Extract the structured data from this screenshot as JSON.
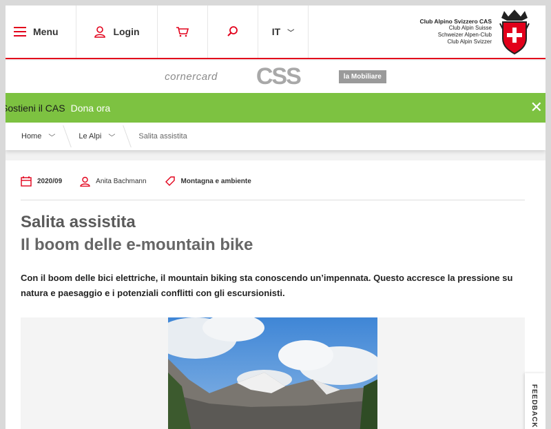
{
  "header": {
    "menu_label": "Menu",
    "login_label": "Login",
    "lang_label": "IT",
    "logo_lines": [
      "Club Alpino Svizzero CAS",
      "Club Alpin Suisse",
      "Schweizer Alpen-Club",
      "Club Alpin Svizzer"
    ]
  },
  "sponsors": {
    "s1": "cornercard",
    "s2": "CSS",
    "s3": "la Mobiliare"
  },
  "banner": {
    "lead": "Sostieni il CAS",
    "cta": "Dona ora",
    "close": "✕"
  },
  "breadcrumb": {
    "items": [
      "Home",
      "Le Alpi",
      "Salita assistita"
    ]
  },
  "article": {
    "date": "2020/09",
    "author": "Anita Bachmann",
    "category": "Montagna e ambiente",
    "title": "Salita assistita",
    "subtitle": "Il boom delle e-mountain bike",
    "lead": "Con il boom delle bici elettriche, il mountain biking sta conoscendo un’impennata. Questo accresce la pressione su natura e paesaggio e i potenziali conflitti con gli escursionisti."
  },
  "feedback": {
    "label": "FEEDBACK"
  },
  "colors": {
    "brand": "#e2001a",
    "banner": "#7dc241"
  }
}
